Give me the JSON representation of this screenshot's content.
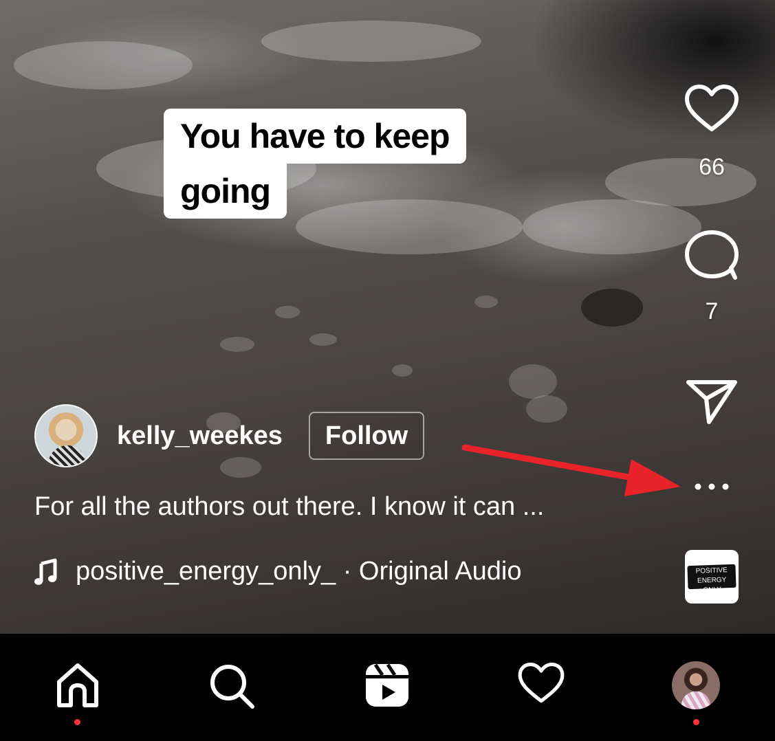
{
  "overlay_caption": {
    "line1": "You have to keep",
    "line2": "going"
  },
  "actions": {
    "like_icon": "heart-outline",
    "like_count": "66",
    "comment_icon": "speech-bubble-outline",
    "comment_count": "7",
    "share_icon": "paper-plane",
    "more_icon": "ellipsis-horizontal"
  },
  "author": {
    "username": "kelly_weekes",
    "follow_label": "Follow"
  },
  "description": "For all the authors out there. I know it can ...",
  "audio": {
    "icon": "music-note",
    "label": "positive_energy_only_ · Original Audio",
    "thumb_text_1": "POSITIVE ENERGY",
    "thumb_text_2": "ONLY"
  },
  "annotation": {
    "arrow_color": "#e8232a"
  },
  "bottom_nav": {
    "items": [
      "home-icon",
      "search-icon",
      "reels-icon",
      "heart-icon",
      "profile-avatar"
    ],
    "notification_dot_color": "#ff3040"
  }
}
